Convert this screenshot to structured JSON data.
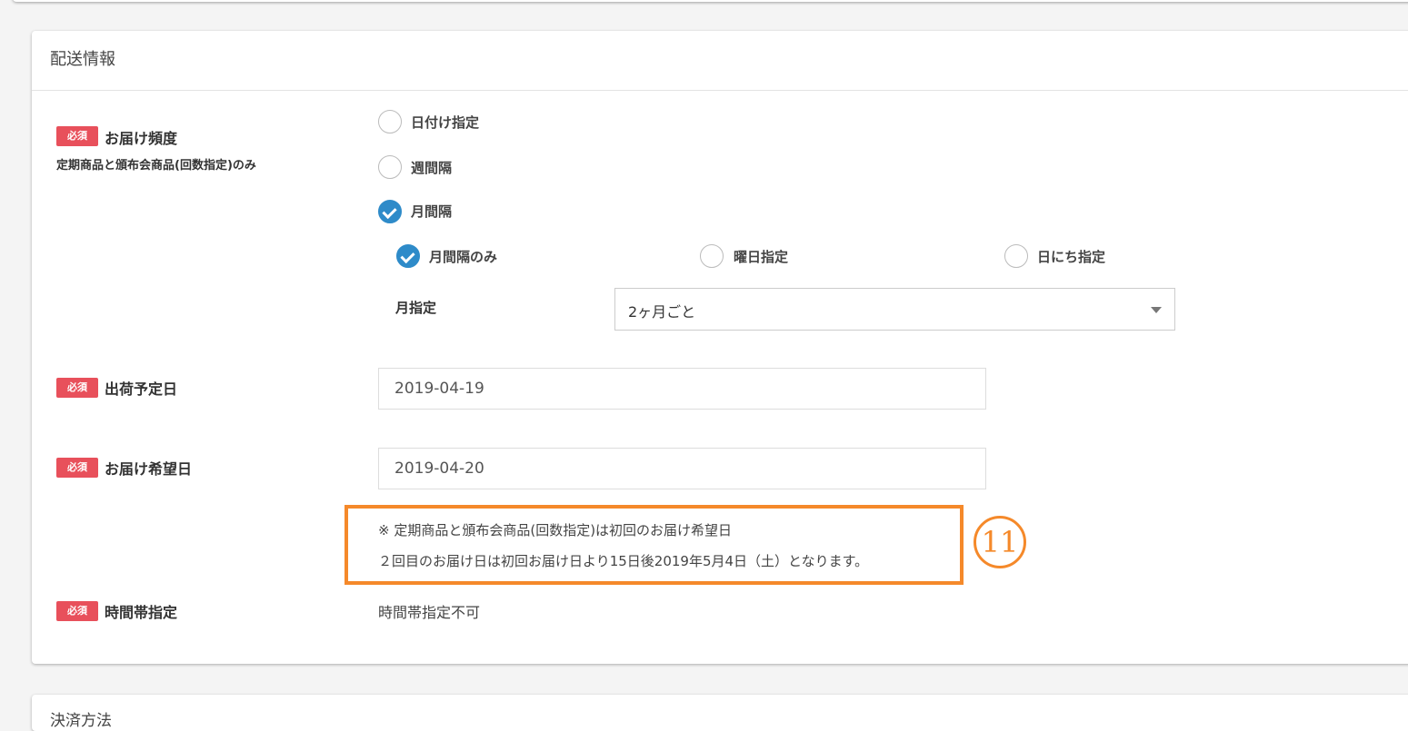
{
  "section_title": "配送情報",
  "next_section_title": "決済方法",
  "required_badge": "必須",
  "frequency": {
    "label": "お届け頻度",
    "note": "定期商品と頒布会商品(回数指定)のみ",
    "options": [
      "日付け指定",
      "週間隔",
      "月間隔"
    ],
    "selected": "月間隔",
    "sub_options": [
      "月間隔のみ",
      "曜日指定",
      "日にち指定"
    ],
    "sub_selected": "月間隔のみ",
    "month_label": "月指定",
    "month_value": "2ヶ月ごと"
  },
  "ship_date": {
    "label": "出荷予定日",
    "value": "2019-04-19"
  },
  "delivery_date": {
    "label": "お届け希望日",
    "value": "2019-04-20"
  },
  "notice": {
    "line1": "※ 定期商品と頒布会商品(回数指定)は初回のお届け希望日",
    "line2": "２回目のお届け日は初回お届け日より15日後2019年5月4日（土）となります。",
    "marker": "11"
  },
  "time_slot": {
    "label": "時間帯指定",
    "value": "時間帯指定不可"
  },
  "colors": {
    "required": "#e8505b",
    "checked": "#2e8bc9",
    "highlight": "#f5892a"
  }
}
